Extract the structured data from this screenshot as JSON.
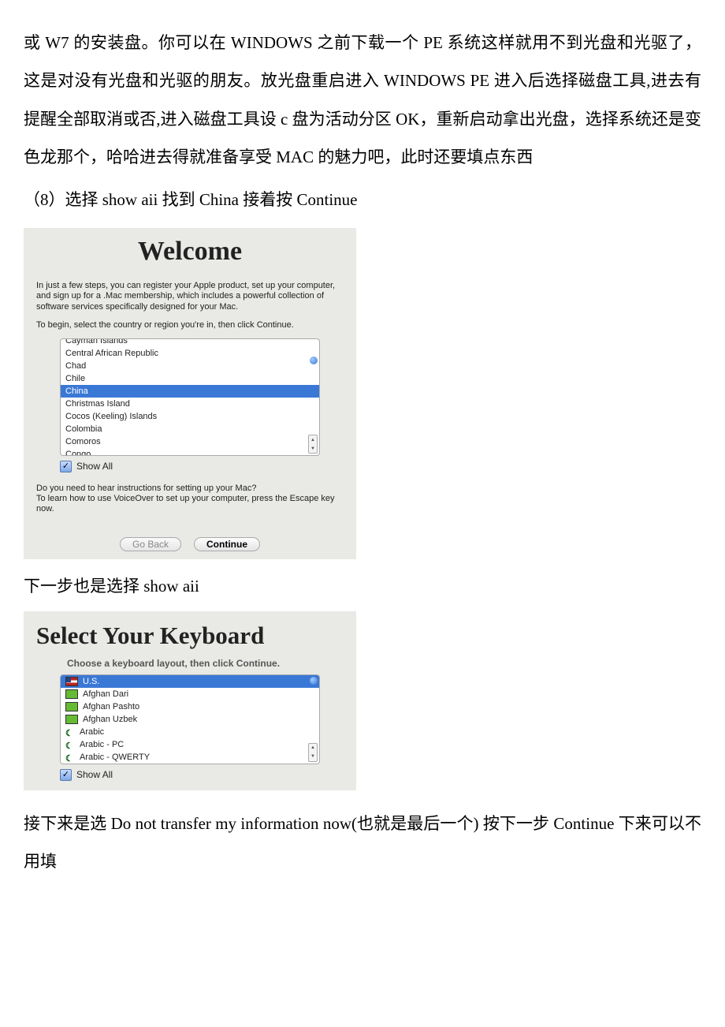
{
  "para1": "或 W7 的安装盘。你可以在 WINDOWS 之前下载一个 PE 系统这样就用不到光盘和光驱了，这是对没有光盘和光驱的朋友。放光盘重启进入 WINDOWS PE 进入后选择磁盘工具,进去有提醒全部取消或否,进入磁盘工具设 c 盘为活动分区 OK，重新启动拿出光盘，选择系统还是变色龙那个，哈哈进去得就准备享受 MAC 的魅力吧，此时还要填点东西",
  "step8": "（8）选择 show aii 找到 China 接着按 Continue",
  "welcome": {
    "title": "Welcome",
    "p1": "In just a few steps, you can register your Apple product, set up your computer, and sign up for a .Mac membership, which includes a powerful collection of software services specifically designed for your Mac.",
    "p2": "To begin, select the country or region you're in, then click Continue.",
    "countries": [
      "Cayman Islands",
      "Central African Republic",
      "Chad",
      "Chile",
      "China",
      "Christmas Island",
      "Cocos (Keeling) Islands",
      "Colombia",
      "Comoros",
      "Congo"
    ],
    "selected": "China",
    "showAll": "Show All",
    "voice1": "Do you need to hear instructions for setting up your Mac?",
    "voice2": "To learn how to use VoiceOver to set up your computer, press the Escape key now.",
    "goBack": "Go Back",
    "cont": "Continue"
  },
  "midLine": "下一步也是选择 show aii",
  "keyboard": {
    "title": "Select Your Keyboard",
    "sub": "Choose a keyboard layout, then click Continue.",
    "items": [
      "U.S.",
      "Afghan Dari",
      "Afghan Pashto",
      "Afghan Uzbek",
      "Arabic",
      "Arabic - PC",
      "Arabic - QWERTY"
    ],
    "selected": "U.S.",
    "showAll": "Show All"
  },
  "bottom": "接下来是选 Do not transfer my information now(也就是最后一个) 按下一步 Continue 下来可以不用填"
}
